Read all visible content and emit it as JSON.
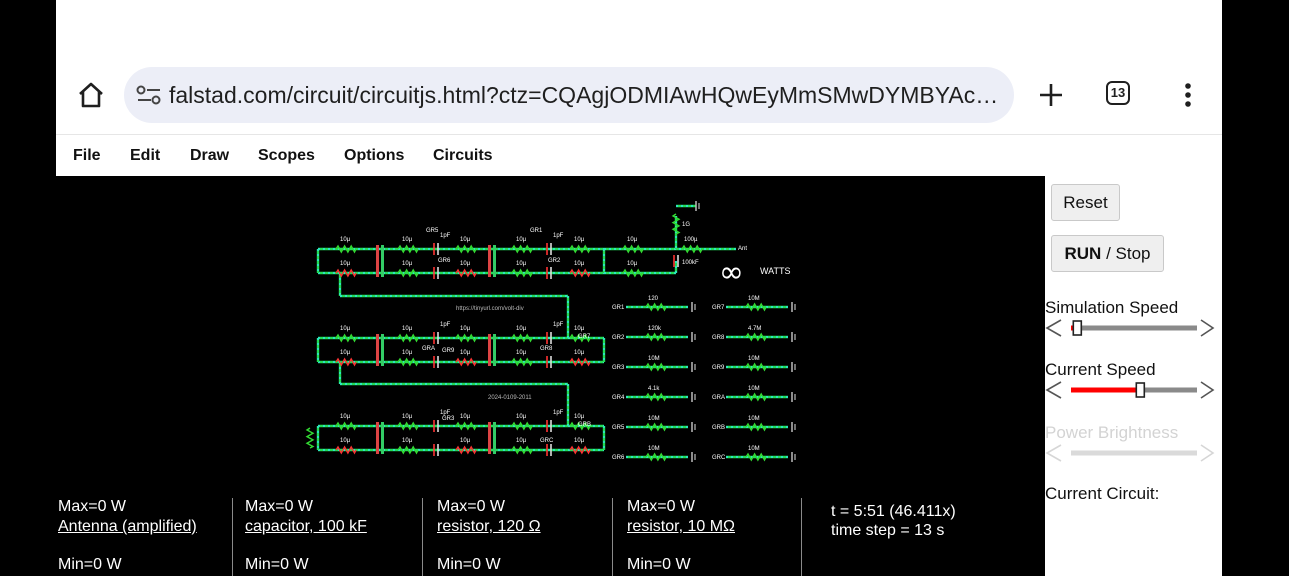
{
  "browser": {
    "url": "falstad.com/circuit/circuitjs.html?ctz=CQAgjODMIAwHQwEyMmSMwDYMBYAcOi...",
    "tab_count": "13"
  },
  "menubar": {
    "items": [
      "File",
      "Edit",
      "Draw",
      "Scopes",
      "Options",
      "Circuits"
    ]
  },
  "circuit": {
    "url_label": "https://tinyurl.com/volt-div",
    "date_label": "2024-0109-2011",
    "power_value": "∞",
    "power_unit": "WATTS",
    "labels": {
      "r10u": "10µ",
      "c1pF": "1pF",
      "r100u": "100µ",
      "r1G": "1G",
      "c100kF": "100kF",
      "ant": "Ant",
      "GR1": "GR1",
      "GR2": "GR2",
      "GR3": "GR3",
      "GR4": "GR4",
      "GR5": "GR5",
      "GR6": "GR6",
      "GR7": "GR7",
      "GR8": "GR8",
      "GR9": "GR9",
      "GRA": "GRA",
      "GRB": "GRB",
      "GRC": "GRC"
    },
    "ground_resistors": [
      {
        "name": "GR1",
        "value": "120"
      },
      {
        "name": "GR2",
        "value": "120k"
      },
      {
        "name": "GR3",
        "value": "10M"
      },
      {
        "name": "GR4",
        "value": "4.1k"
      },
      {
        "name": "GR5",
        "value": "10M"
      },
      {
        "name": "GR6",
        "value": "10M"
      },
      {
        "name": "GR7",
        "value": "10M"
      },
      {
        "name": "GR8",
        "value": "4.7M"
      },
      {
        "name": "GR9",
        "value": "10M"
      },
      {
        "name": "GRA",
        "value": "10M"
      },
      {
        "name": "GRB",
        "value": "10M"
      },
      {
        "name": "GRC",
        "value": "10M"
      }
    ]
  },
  "scopes": [
    {
      "max": "Max=0 W",
      "name": "Antenna (amplified)",
      "min": "Min=0 W"
    },
    {
      "max": "Max=0 W",
      "name": "capacitor, 100 kF",
      "min": "Min=0 W"
    },
    {
      "max": "Max=0 W",
      "name": "resistor, 120 Ω",
      "min": "Min=0 W"
    },
    {
      "max": "Max=0 W",
      "name": "resistor, 10 MΩ",
      "min": "Min=0 W"
    }
  ],
  "sim_info": {
    "time": "t = 5:51 (46.411x)",
    "step": "time step = 13 s"
  },
  "panel": {
    "reset_label": "Reset",
    "run_label": "RUN",
    "stop_label": " / Stop",
    "sim_speed_label": "Simulation Speed",
    "current_speed_label": "Current Speed",
    "power_brightness_label": "Power Brightness",
    "current_circuit_label": "Current Circuit:"
  },
  "sliders": {
    "simulation_speed": 0.05,
    "current_speed": 0.55,
    "power_brightness": 0.0
  },
  "colors": {
    "wire_cyan": "#2ee6e6",
    "wire_green": "#22dd55",
    "wire_gray": "#8a8a8a",
    "resistor_green": "#33dd33",
    "capacitor_red": "#ff3333",
    "slider_red": "#ff0000",
    "menubar_bg": "#ffffff",
    "omnibox_bg": "#eceef7"
  }
}
